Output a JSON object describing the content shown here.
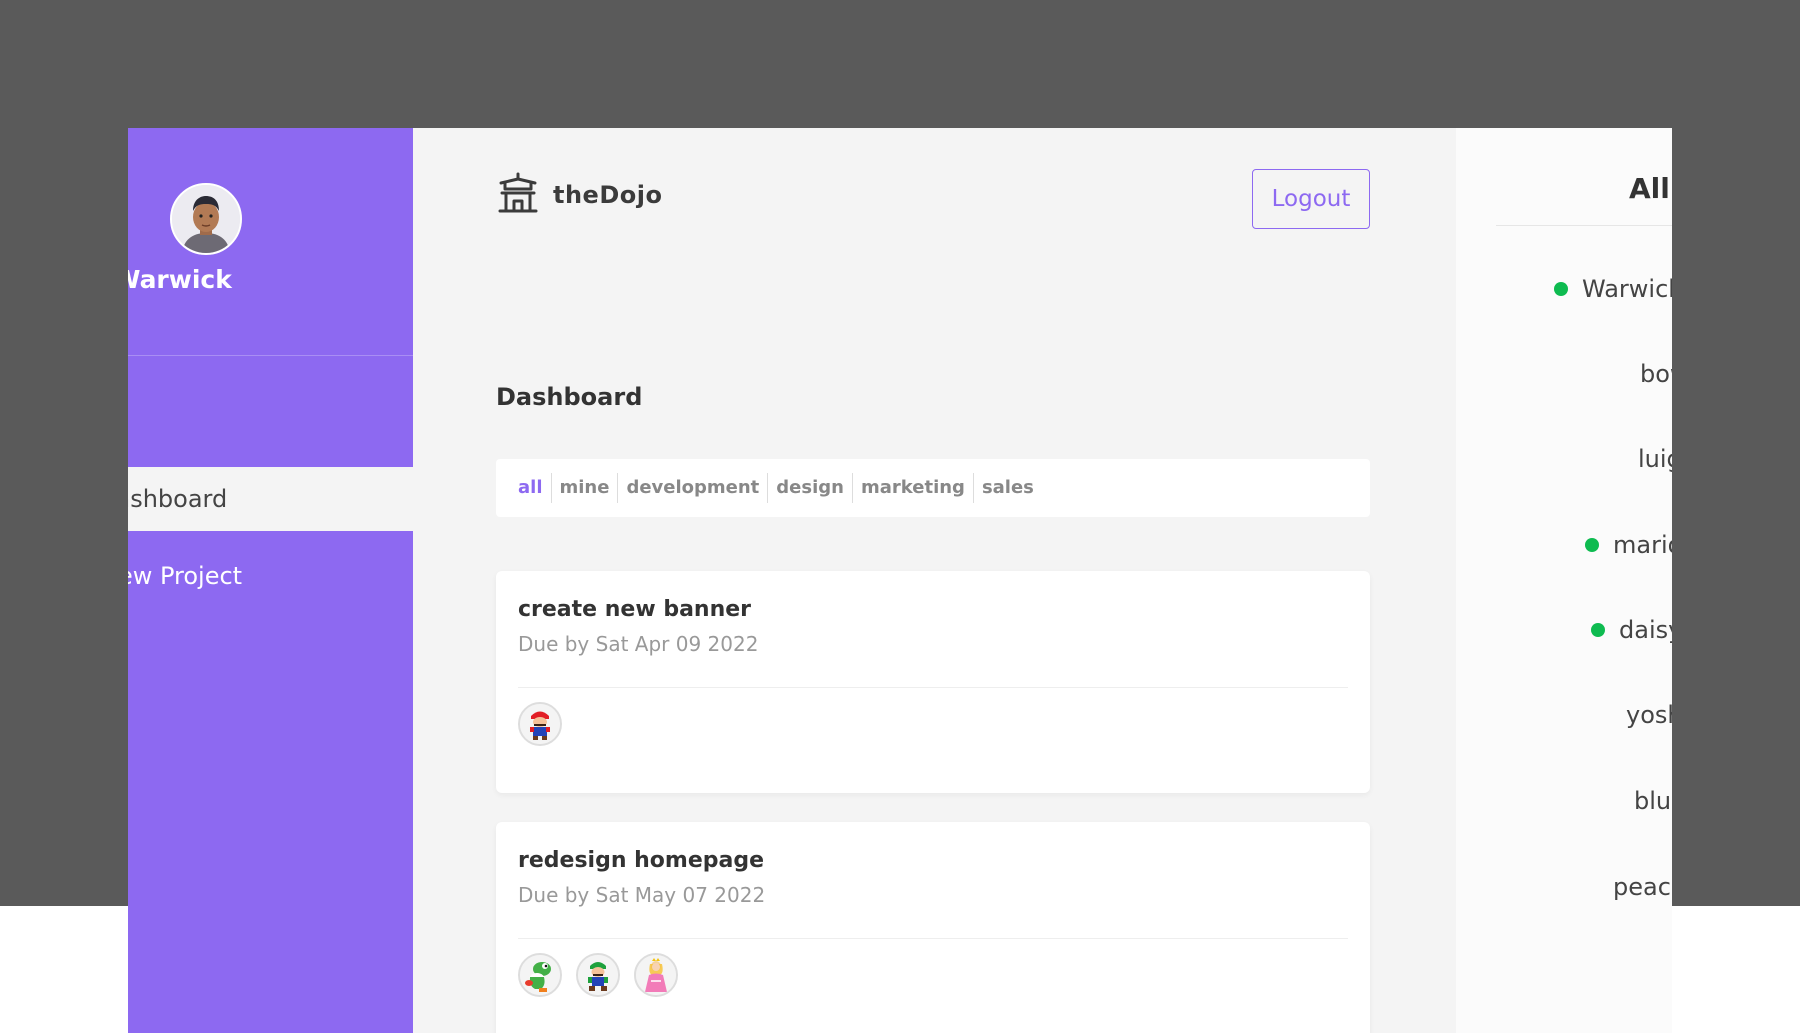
{
  "sidebar": {
    "greeting": "Hey Warwick",
    "nav": [
      {
        "label": "Dashboard",
        "active": true
      },
      {
        "label": "New Project",
        "active": false
      }
    ]
  },
  "header": {
    "logo_text": "theDojo",
    "logout_label": "Logout"
  },
  "main": {
    "page_title": "Dashboard",
    "filters": [
      "all",
      "mine",
      "development",
      "design",
      "marketing",
      "sales"
    ],
    "active_filter": "all",
    "projects": [
      {
        "title": "create new banner",
        "due": "Due by Sat Apr 09 2022",
        "assigned": [
          "mario"
        ]
      },
      {
        "title": "redesign homepage",
        "due": "Due by Sat May 07 2022",
        "assigned": [
          "yoshi",
          "luigi",
          "peach"
        ]
      }
    ]
  },
  "userlist": {
    "title": "All Users",
    "users": [
      {
        "name": "Warwick",
        "online": true
      },
      {
        "name": "bowser",
        "online": false
      },
      {
        "name": "luigi",
        "online": false
      },
      {
        "name": "mario",
        "online": true
      },
      {
        "name": "daisy",
        "online": true
      },
      {
        "name": "yoshi",
        "online": false
      },
      {
        "name": "blue",
        "online": false
      },
      {
        "name": "peach",
        "online": false
      }
    ]
  },
  "colors": {
    "accent": "#8d69f1",
    "online": "#0ebb50",
    "backdrop": "#5a5a5a"
  }
}
